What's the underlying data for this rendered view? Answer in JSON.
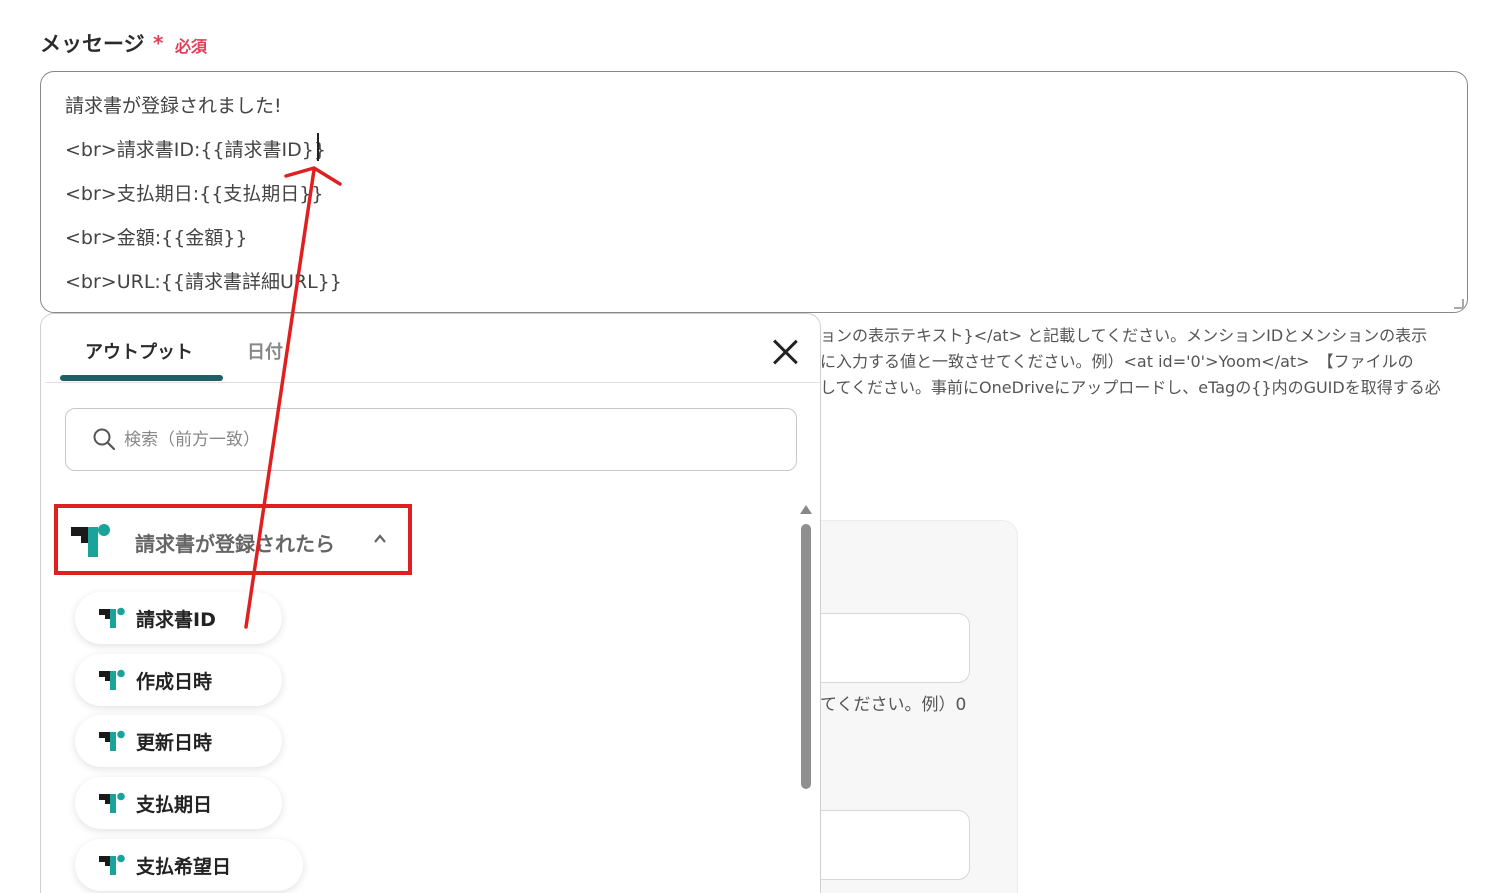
{
  "field": {
    "label": "メッセージ",
    "required_mark": "*",
    "required_text": "必須"
  },
  "message": {
    "lines": [
      "請求書が登録されました!",
      "<br>請求書ID:{{請求書ID}}",
      "<br>支払期日:{{支払期日}}",
      "<br>金額:{{金額}}",
      "<br>URL:{{請求書詳細URL}}"
    ]
  },
  "help": {
    "lines": [
      "ョンの表示テキスト}</at> と記載してください。メンションIDとメンションの表示",
      "に入力する値と一致させてください。例）<at id='0'>Yoom</at>　【ファイルの",
      "してください。事前にOneDriveにアップロードし、eTagの{}内のGUIDを取得する必"
    ]
  },
  "background": {
    "hint_text": "てください。例）0"
  },
  "popup": {
    "tabs": [
      "アウトプット",
      "日付"
    ],
    "search_placeholder": "検索（前方一致）",
    "group": {
      "label": "請求書が登録されたら",
      "icon": "chevron-up-icon"
    },
    "items": [
      "請求書ID",
      "作成日時",
      "更新日時",
      "支払期日",
      "支払希望日"
    ]
  },
  "colors": {
    "required": "#e0405a",
    "tab_accent": "#1e5f66",
    "annotation": "#e02020",
    "logo_dark": "#1a1a1a",
    "logo_teal": "#1aa39a"
  }
}
